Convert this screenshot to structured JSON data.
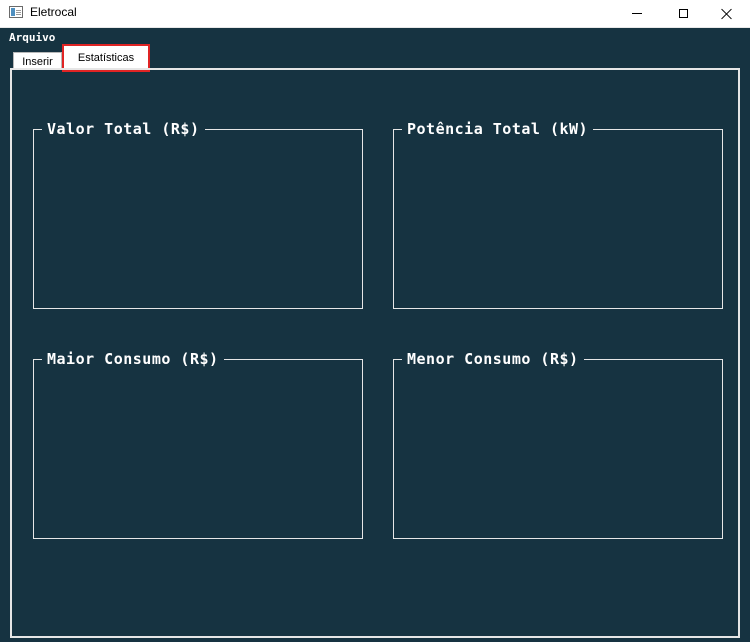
{
  "window": {
    "title": "Eletrocal",
    "icon": "app-window-icon",
    "controls": [
      "minimize-icon",
      "maximize-icon",
      "close-icon"
    ]
  },
  "menu": {
    "arquivo": "Arquivo"
  },
  "tabs": [
    {
      "label": "Inserir",
      "selected": false
    },
    {
      "label": "Estatísticas",
      "selected": true
    }
  ],
  "groups": [
    {
      "title": "Valor Total (R$)"
    },
    {
      "title": "Potência Total (kW)"
    },
    {
      "title": "Maior Consumo (R$)"
    },
    {
      "title": "Menor Consumo (R$)"
    }
  ],
  "colors": {
    "background": "#163341",
    "border": "#e6e6e6",
    "highlight": "#e02424",
    "text": "#ffffff"
  }
}
